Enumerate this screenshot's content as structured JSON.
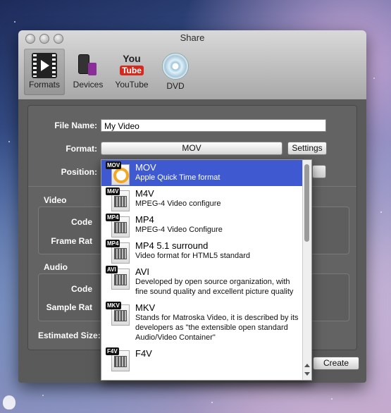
{
  "window": {
    "title": "Share"
  },
  "toolbar": {
    "items": [
      {
        "label": "Formats",
        "icon": "film-icon"
      },
      {
        "label": "Devices",
        "icon": "ipod-icon"
      },
      {
        "label": "YouTube",
        "icon": "youtube-icon",
        "logo_top": "You",
        "logo_bottom": "Tube"
      },
      {
        "label": "DVD",
        "icon": "dvd-icon"
      }
    ]
  },
  "form": {
    "file_name_label": "File Name:",
    "file_name_value": "My Video",
    "format_label": "Format:",
    "format_value": "MOV",
    "settings_label": "Settings",
    "position_label": "Position:",
    "video_section": "Video",
    "codec_label_video": "Code",
    "frame_rate_label": "Frame Rat",
    "audio_section": "Audio",
    "codec_label_audio": "Code",
    "sample_rate_label": "Sample Rat",
    "estimated_size_label": "Estimated Size: 1",
    "create_label": "Create"
  },
  "dropdown": {
    "items": [
      {
        "tag": "MOV",
        "title": "MOV",
        "desc": "Apple Quick Time format",
        "selected": true
      },
      {
        "tag": "M4V",
        "title": "M4V",
        "desc": "MPEG-4 Video configure",
        "selected": false
      },
      {
        "tag": "MP4",
        "title": "MP4",
        "desc": "MPEG-4 Video Configure",
        "selected": false
      },
      {
        "tag": "MP4",
        "title": "MP4 5.1 surround",
        "desc": "Video format for HTML5 standard",
        "selected": false
      },
      {
        "tag": "AVI",
        "title": "AVI",
        "desc": "Developed by open source organization, with fine sound quality and excellent picture quality",
        "selected": false
      },
      {
        "tag": "MKV",
        "title": "MKV",
        "desc": "Stands for Matroska Video, it is described by its developers as \"the extensible open standard Audio/Video Container\"",
        "selected": false
      },
      {
        "tag": "F4V",
        "title": "F4V",
        "desc": "",
        "selected": false
      }
    ]
  },
  "colors": {
    "selection": "#3f5ad1",
    "panel": "#636363"
  }
}
